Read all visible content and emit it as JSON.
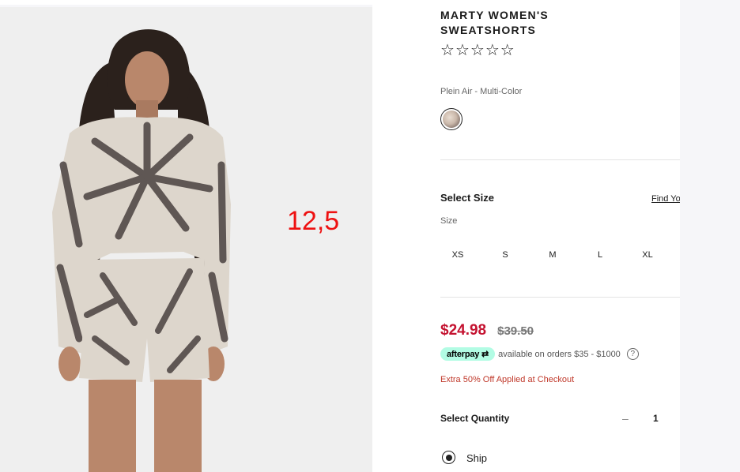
{
  "product": {
    "title": "MARTY WOMEN'S SWEATSHORTS",
    "rating_stars": 5,
    "rating_value": 0,
    "color_name": "Plein Air - Multi-Color"
  },
  "size": {
    "heading": "Select Size",
    "find_link": "Find Yo",
    "label": "Size",
    "options": [
      "XS",
      "S",
      "M",
      "L",
      "XL"
    ]
  },
  "price": {
    "sale": "$24.98",
    "original": "$39.50"
  },
  "afterpay": {
    "badge": "afterpay",
    "text": "available on orders $35 - $1000",
    "help": "?"
  },
  "promo": "Extra 50% Off Applied at Checkout",
  "quantity": {
    "heading": "Select Quantity",
    "minus": "–",
    "value": "1"
  },
  "fulfillment": {
    "ship_label": "Ship",
    "selected": true
  },
  "annotation": "12,5",
  "colors": {
    "sale_price": "#c41230",
    "promo": "#c0392b",
    "afterpay_mint": "#b2fce4",
    "annotation": "#ee1111"
  },
  "icons": {
    "star": "star-outline-icon",
    "help": "question-circle-icon",
    "afterpay": "afterpay-arrow-icon"
  }
}
